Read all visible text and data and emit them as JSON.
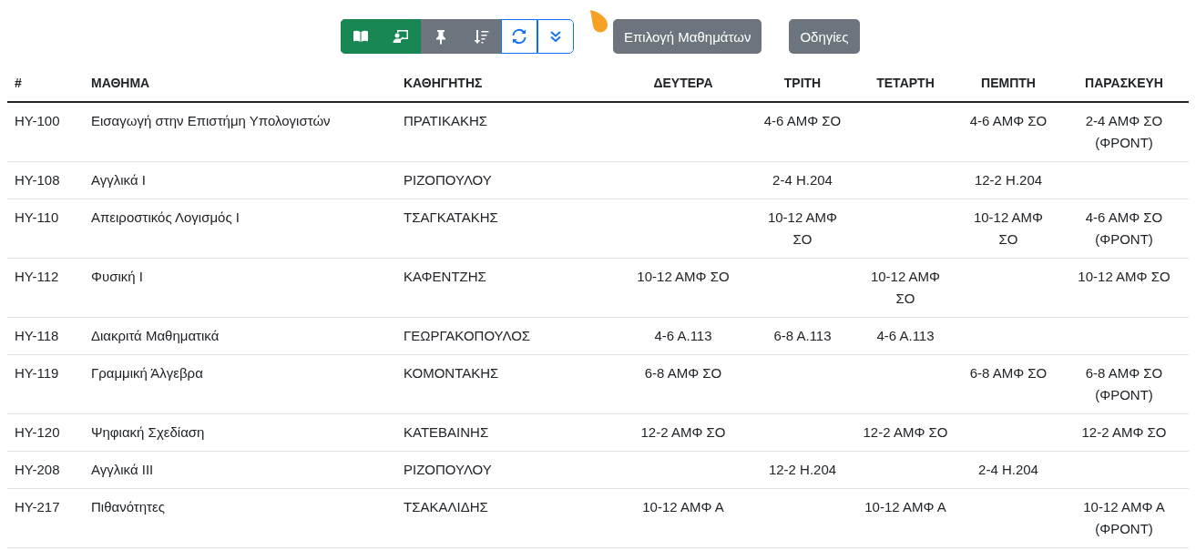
{
  "toolbar": {
    "buttons": [
      {
        "kind": "success"
      },
      {
        "kind": "success"
      },
      {
        "kind": "secondary"
      },
      {
        "kind": "secondary"
      },
      {
        "kind": "outline"
      },
      {
        "kind": "outline"
      }
    ]
  },
  "actions": [
    "Επιλογή Μαθημάτων",
    "Οδηγίες"
  ],
  "table": {
    "columns": [
      "#",
      "ΜΑΘΗΜΑ",
      "ΚΑΘΗΓΗΤΗΣ",
      "ΔΕΥΤΕΡΑ",
      "ΤΡΙΤΗ",
      "ΤΕΤΑΡΤΗ",
      "ΠΕΜΠΤΗ",
      "ΠΑΡΑΣΚΕΥΗ"
    ],
    "rows": [
      [
        "ΗΥ-100",
        "Εισαγωγή στην Επιστήμη Υπολογιστών",
        "ΠΡΑΤΙΚΑΚΗΣ",
        "",
        "4-6 ΑΜΦ ΣΟ",
        "",
        "4-6 ΑΜΦ ΣΟ",
        "2-4 ΑΜΦ ΣΟ (ΦΡΟΝΤ)"
      ],
      [
        "ΗΥ-108",
        "Αγγλικά I",
        "ΡΙΖΟΠΟΥΛΟΥ",
        "",
        "2-4 Η.204",
        "",
        "12-2 Η.204",
        ""
      ],
      [
        "ΗΥ-110",
        "Απειροστικός Λογισμός I",
        "ΤΣΑΓΚΑΤΑΚΗΣ",
        "",
        "10-12 ΑΜΦ ΣΟ",
        "",
        "10-12 ΑΜΦ ΣΟ",
        "4-6 ΑΜΦ ΣΟ (ΦΡΟΝΤ)"
      ],
      [
        "ΗΥ-112",
        "Φυσική I",
        "ΚΑΦΕΝΤΖΗΣ",
        "10-12 ΑΜΦ ΣΟ",
        "",
        "10-12 ΑΜΦ ΣΟ",
        "",
        "10-12 ΑΜΦ ΣΟ"
      ],
      [
        "ΗΥ-118",
        "Διακριτά Μαθηματικά",
        "ΓΕΩΡΓΑΚΟΠΟΥΛΟΣ",
        "4-6 Α.113",
        "6-8 Α.113",
        "4-6 Α.113",
        "",
        ""
      ],
      [
        "ΗΥ-119",
        "Γραμμική Άλγεβρα",
        "ΚΟΜΟΝΤΑΚΗΣ",
        "6-8 ΑΜΦ ΣΟ",
        "",
        "",
        "6-8 ΑΜΦ ΣΟ",
        "6-8 ΑΜΦ ΣΟ (ΦΡΟΝΤ)"
      ],
      [
        "ΗΥ-120",
        "Ψηφιακή Σχεδίαση",
        "ΚΑΤΕΒΑΙΝΗΣ",
        "12-2 ΑΜΦ ΣΟ",
        "",
        "12-2 ΑΜΦ ΣΟ",
        "",
        "12-2 ΑΜΦ ΣΟ"
      ],
      [
        "ΗΥ-208",
        "Αγγλικά III",
        "ΡΙΖΟΠΟΥΛΟΥ",
        "",
        "12-2 Η.204",
        "",
        "2-4 Η.204",
        ""
      ],
      [
        "ΗΥ-217",
        "Πιθανότητες",
        "ΤΣΑΚΑΛΙΔΗΣ",
        "10-12 ΑΜΦ Α",
        "",
        "10-12 ΑΜΦ Α",
        "",
        "10-12 ΑΜΦ Α (ΦΡΟΝΤ)"
      ]
    ]
  }
}
